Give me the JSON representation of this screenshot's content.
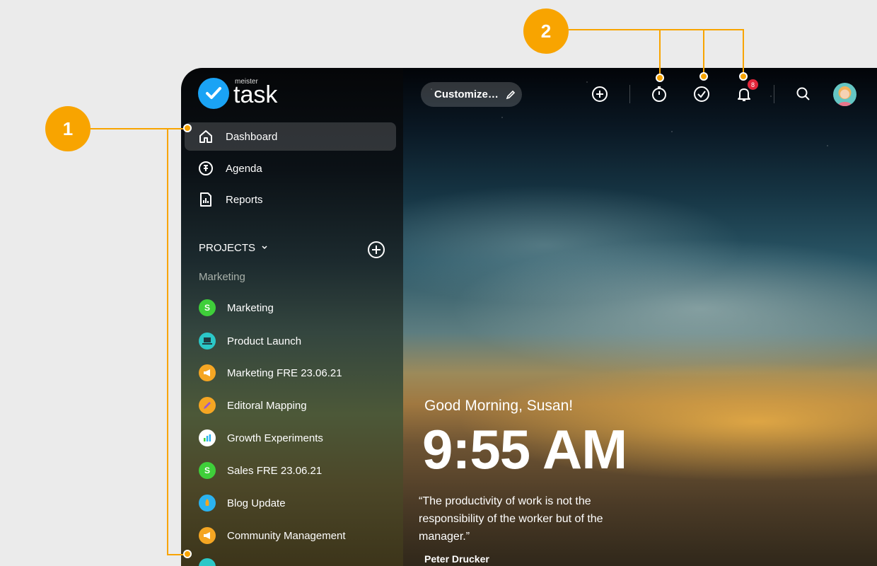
{
  "callouts": {
    "one": "1",
    "two": "2"
  },
  "logo": {
    "top": "meister",
    "main": "task"
  },
  "nav": {
    "dashboard": "Dashboard",
    "agenda": "Agenda",
    "reports": "Reports"
  },
  "projects": {
    "header": "PROJECTS",
    "group": "Marketing",
    "items": [
      {
        "label": "Marketing",
        "icon": "S",
        "color": "#3fcf3a"
      },
      {
        "label": "Product Launch",
        "icon": "laptop-icon",
        "color": "#2bc8c8"
      },
      {
        "label": "Marketing FRE 23.06.21",
        "icon": "megaphone-icon",
        "color": "#f5a623"
      },
      {
        "label": "Editoral Mapping",
        "icon": "pencil-icon",
        "color": "#f5a623"
      },
      {
        "label": "Growth Experiments",
        "icon": "bar-chart-icon",
        "color": "#ffffff"
      },
      {
        "label": "Sales FRE 23.06.21",
        "icon": "S",
        "color": "#3fcf3a"
      },
      {
        "label": "Blog Update",
        "icon": "rocket-icon",
        "color": "#2bb3f0"
      },
      {
        "label": "Community Management",
        "icon": "megaphone-icon",
        "color": "#f5a623"
      }
    ]
  },
  "topbar": {
    "customize": "Customize…",
    "notification_count": "8"
  },
  "greeting": {
    "hello": "Good Morning, Susan!",
    "time": "9:55 AM",
    "quote": "“The productivity of work is not the responsibility of the worker but of the manager.”",
    "author": "Peter Drucker"
  },
  "colors": {
    "accent": "#f8a400",
    "brand": "#1aa3f5",
    "badge": "#e2253a"
  }
}
